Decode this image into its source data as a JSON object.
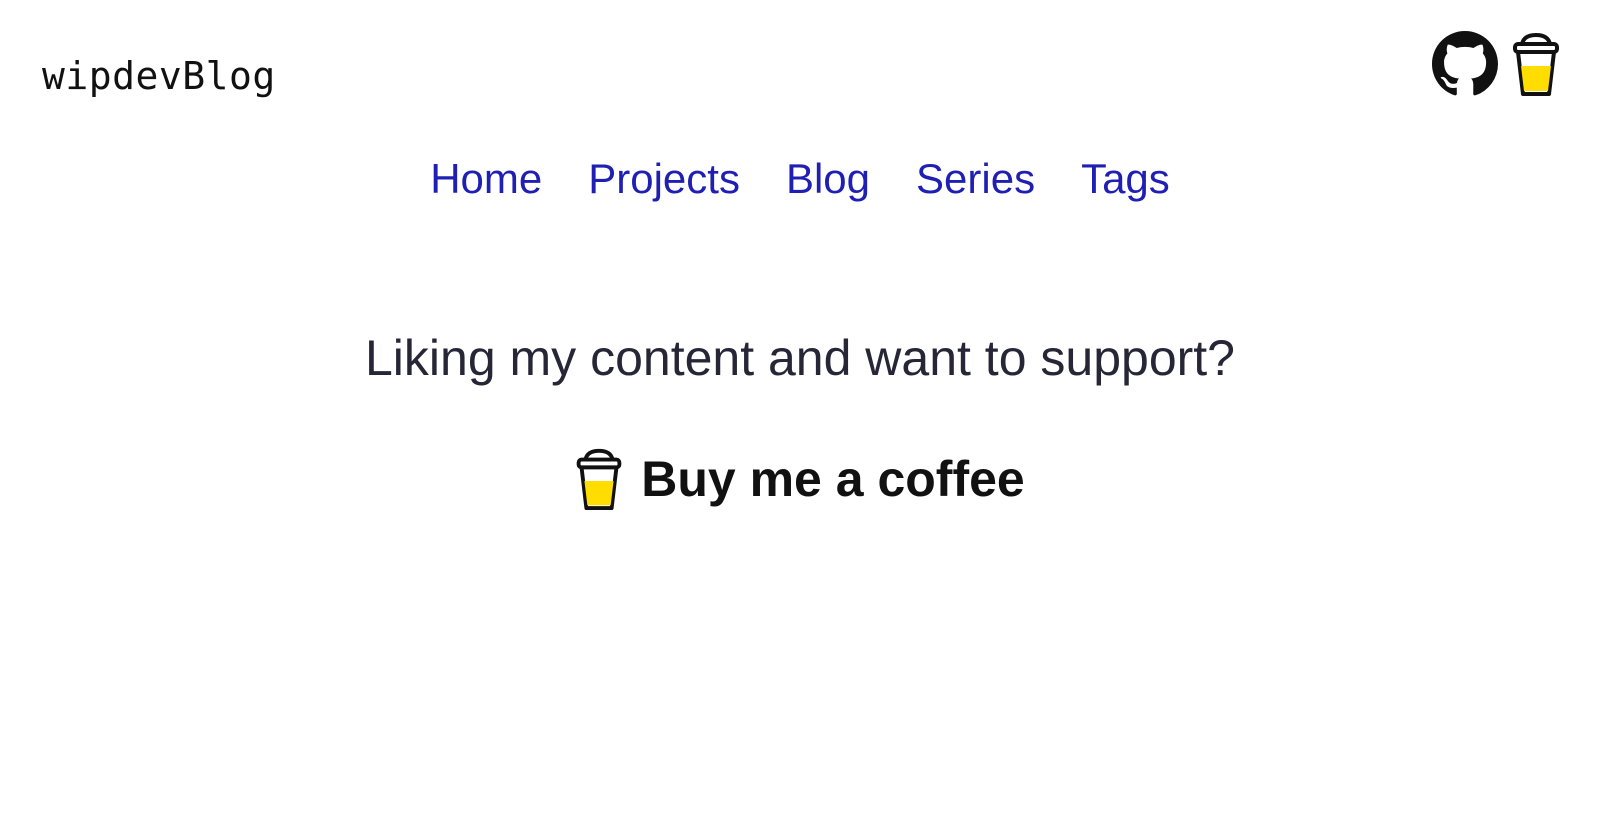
{
  "site": {
    "logo_text": "wipdevBlog"
  },
  "header_icons": [
    {
      "icon": "github-icon"
    },
    {
      "icon": "coffee-cup-icon"
    }
  ],
  "nav": {
    "items": [
      {
        "label": "Home"
      },
      {
        "label": "Projects"
      },
      {
        "label": "Blog"
      },
      {
        "label": "Series"
      },
      {
        "label": "Tags"
      }
    ]
  },
  "support": {
    "prompt": "Liking my content and want to support?",
    "button_label": "Buy me a coffee",
    "button_icon": "coffee-cup-icon"
  },
  "colors": {
    "nav_link": "#1f1fb4",
    "text": "#262636",
    "cup_fill": "#ffdd00",
    "background": "#ffffff"
  }
}
